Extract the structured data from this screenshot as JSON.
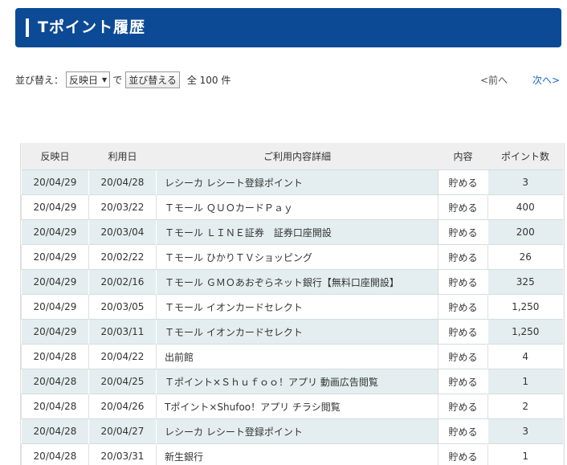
{
  "header": {
    "title": "Tポイント履歴"
  },
  "sort": {
    "label": "並び替え：",
    "selected": "反映日",
    "de": "で",
    "button": "並び替える",
    "total": "全 100 件"
  },
  "pagination": {
    "prev": "<前へ",
    "next": "次へ>"
  },
  "table": {
    "headers": [
      "反映日",
      "利用日",
      "ご利用内容詳細",
      "内容",
      "ポイント数"
    ],
    "rows": [
      [
        "20/04/29",
        "20/04/28",
        "レシーカ レシート登録ポイント",
        "貯める",
        "3"
      ],
      [
        "20/04/29",
        "20/03/22",
        "Ｔモール ＱＵＯカードＰａｙ",
        "貯める",
        "400"
      ],
      [
        "20/04/29",
        "20/03/04",
        "Ｔモール ＬＩＮＥ証券　証券口座開設",
        "貯める",
        "200"
      ],
      [
        "20/04/29",
        "20/02/22",
        "Ｔモール ひかりＴＶショッピング",
        "貯める",
        "26"
      ],
      [
        "20/04/29",
        "20/02/16",
        "Ｔモール ＧＭＯあおぞらネット銀行【無料口座開設】",
        "貯める",
        "325"
      ],
      [
        "20/04/29",
        "20/03/05",
        "Ｔモール イオンカードセレクト",
        "貯める",
        "1,250"
      ],
      [
        "20/04/29",
        "20/03/11",
        "Ｔモール イオンカードセレクト",
        "貯める",
        "1,250"
      ],
      [
        "20/04/28",
        "20/04/22",
        "出前館",
        "貯める",
        "4"
      ],
      [
        "20/04/28",
        "20/04/25",
        "Ｔポイント×Ｓｈｕｆｏｏ！アプリ 動画広告閲覧",
        "貯める",
        "1"
      ],
      [
        "20/04/28",
        "20/04/26",
        "Tポイント×Shufoo！アプリ チラシ閲覧",
        "貯める",
        "2"
      ],
      [
        "20/04/28",
        "20/04/27",
        "レシーカ レシート登録ポイント",
        "貯める",
        "3"
      ],
      [
        "20/04/28",
        "20/03/31",
        "新生銀行",
        "貯める",
        "1"
      ]
    ]
  }
}
